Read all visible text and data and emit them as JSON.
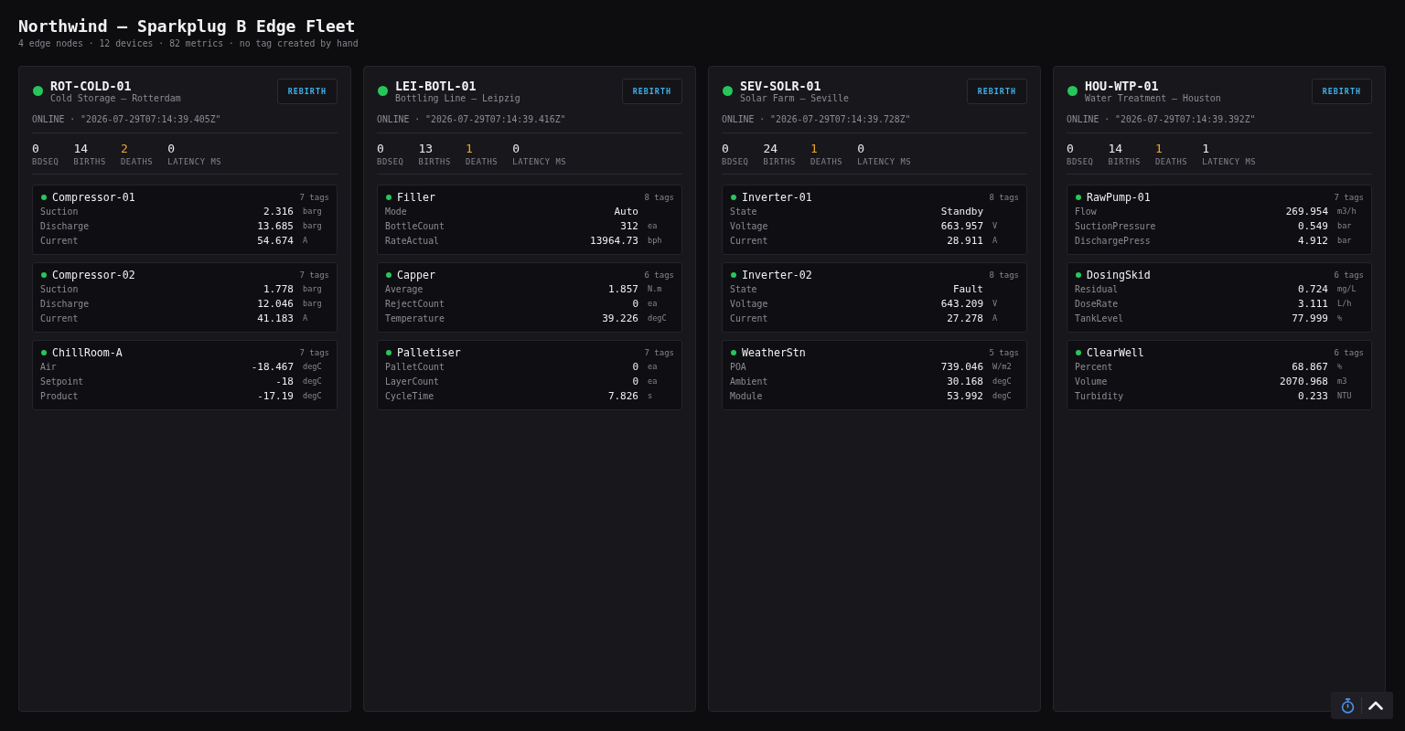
{
  "header": {
    "title": "Northwind — Sparkplug B Edge Fleet",
    "subtitle": "4 edge nodes · 12 devices · 82 metrics · no tag created by hand"
  },
  "nodes": [
    {
      "name": "ROT-COLD-01",
      "location": "Cold Storage — Rotterdam",
      "online": true,
      "action": "REBIRTH",
      "status_line": "ONLINE · \"2026-07-29T07:14:39.405Z\"",
      "stats": [
        {
          "value": "0",
          "label": "BDSEQ",
          "highlighted": false
        },
        {
          "value": "14",
          "label": "BIRTHS",
          "highlighted": false
        },
        {
          "value": "2",
          "label": "DEATHS",
          "highlighted": true
        },
        {
          "value": "0",
          "label": "LATENCY MS",
          "highlighted": false
        }
      ],
      "devices": [
        {
          "name": "Compressor-01",
          "online": true,
          "tags": "7 tags",
          "metrics": [
            {
              "name": "Suction",
              "value": "2.316",
              "unit": "barg"
            },
            {
              "name": "Discharge",
              "value": "13.685",
              "unit": "barg"
            },
            {
              "name": "Current",
              "value": "54.674",
              "unit": "A"
            }
          ]
        },
        {
          "name": "Compressor-02",
          "online": true,
          "tags": "7 tags",
          "metrics": [
            {
              "name": "Suction",
              "value": "1.778",
              "unit": "barg"
            },
            {
              "name": "Discharge",
              "value": "12.046",
              "unit": "barg"
            },
            {
              "name": "Current",
              "value": "41.183",
              "unit": "A"
            }
          ]
        },
        {
          "name": "ChillRoom-A",
          "online": true,
          "tags": "7 tags",
          "metrics": [
            {
              "name": "Air",
              "value": "-18.467",
              "unit": "degC"
            },
            {
              "name": "Setpoint",
              "value": "-18",
              "unit": "degC"
            },
            {
              "name": "Product",
              "value": "-17.19",
              "unit": "degC"
            }
          ]
        }
      ]
    },
    {
      "name": "LEI-BOTL-01",
      "location": "Bottling Line — Leipzig",
      "online": true,
      "action": "REBIRTH",
      "status_line": "ONLINE · \"2026-07-29T07:14:39.416Z\"",
      "stats": [
        {
          "value": "0",
          "label": "BDSEQ",
          "highlighted": false
        },
        {
          "value": "13",
          "label": "BIRTHS",
          "highlighted": false
        },
        {
          "value": "1",
          "label": "DEATHS",
          "highlighted": true
        },
        {
          "value": "0",
          "label": "LATENCY MS",
          "highlighted": false
        }
      ],
      "devices": [
        {
          "name": "Filler",
          "online": true,
          "tags": "8 tags",
          "metrics": [
            {
              "name": "Mode",
              "value": "Auto"
            },
            {
              "name": "BottleCount",
              "value": "312",
              "unit": "ea"
            },
            {
              "name": "RateActual",
              "value": "13964.73",
              "unit": "bph"
            }
          ]
        },
        {
          "name": "Capper",
          "online": true,
          "tags": "6 tags",
          "metrics": [
            {
              "name": "Average",
              "value": "1.857",
              "unit": "N.m"
            },
            {
              "name": "RejectCount",
              "value": "0",
              "unit": "ea"
            },
            {
              "name": "Temperature",
              "value": "39.226",
              "unit": "degC"
            }
          ]
        },
        {
          "name": "Palletiser",
          "online": true,
          "tags": "7 tags",
          "metrics": [
            {
              "name": "PalletCount",
              "value": "0",
              "unit": "ea"
            },
            {
              "name": "LayerCount",
              "value": "0",
              "unit": "ea"
            },
            {
              "name": "CycleTime",
              "value": "7.826",
              "unit": "s"
            }
          ]
        }
      ]
    },
    {
      "name": "SEV-SOLR-01",
      "location": "Solar Farm — Seville",
      "online": true,
      "action": "REBIRTH",
      "status_line": "ONLINE · \"2026-07-29T07:14:39.728Z\"",
      "stats": [
        {
          "value": "0",
          "label": "BDSEQ",
          "highlighted": false
        },
        {
          "value": "24",
          "label": "BIRTHS",
          "highlighted": false
        },
        {
          "value": "1",
          "label": "DEATHS",
          "highlighted": true
        },
        {
          "value": "0",
          "label": "LATENCY MS",
          "highlighted": false
        }
      ],
      "devices": [
        {
          "name": "Inverter-01",
          "online": true,
          "tags": "8 tags",
          "metrics": [
            {
              "name": "State",
              "value": "Standby"
            },
            {
              "name": "Voltage",
              "value": "663.957",
              "unit": "V"
            },
            {
              "name": "Current",
              "value": "28.911",
              "unit": "A"
            }
          ]
        },
        {
          "name": "Inverter-02",
          "online": true,
          "tags": "8 tags",
          "metrics": [
            {
              "name": "State",
              "value": "Fault"
            },
            {
              "name": "Voltage",
              "value": "643.209",
              "unit": "V"
            },
            {
              "name": "Current",
              "value": "27.278",
              "unit": "A"
            }
          ]
        },
        {
          "name": "WeatherStn",
          "online": true,
          "tags": "5 tags",
          "metrics": [
            {
              "name": "POA",
              "value": "739.046",
              "unit": "W/m2"
            },
            {
              "name": "Ambient",
              "value": "30.168",
              "unit": "degC"
            },
            {
              "name": "Module",
              "value": "53.992",
              "unit": "degC"
            }
          ]
        }
      ]
    },
    {
      "name": "HOU-WTP-01",
      "location": "Water Treatment — Houston",
      "online": true,
      "action": "REBIRTH",
      "status_line": "ONLINE · \"2026-07-29T07:14:39.392Z\"",
      "stats": [
        {
          "value": "0",
          "label": "BDSEQ",
          "highlighted": false
        },
        {
          "value": "14",
          "label": "BIRTHS",
          "highlighted": false
        },
        {
          "value": "1",
          "label": "DEATHS",
          "highlighted": true
        },
        {
          "value": "1",
          "label": "LATENCY MS",
          "highlighted": false
        }
      ],
      "devices": [
        {
          "name": "RawPump-01",
          "online": true,
          "tags": "7 tags",
          "metrics": [
            {
              "name": "Flow",
              "value": "269.954",
              "unit": "m3/h"
            },
            {
              "name": "SuctionPressure",
              "value": "0.549",
              "unit": "bar"
            },
            {
              "name": "DischargePress",
              "value": "4.912",
              "unit": "bar"
            }
          ]
        },
        {
          "name": "DosingSkid",
          "online": true,
          "tags": "6 tags",
          "metrics": [
            {
              "name": "Residual",
              "value": "0.724",
              "unit": "mg/L"
            },
            {
              "name": "DoseRate",
              "value": "3.111",
              "unit": "L/h"
            },
            {
              "name": "TankLevel",
              "value": "77.999",
              "unit": "%"
            }
          ]
        },
        {
          "name": "ClearWell",
          "online": true,
          "tags": "6 tags",
          "metrics": [
            {
              "name": "Percent",
              "value": "68.867",
              "unit": "%"
            },
            {
              "name": "Volume",
              "value": "2070.968",
              "unit": "m3"
            },
            {
              "name": "Turbidity",
              "value": "0.233",
              "unit": "NTU"
            }
          ]
        }
      ]
    }
  ]
}
